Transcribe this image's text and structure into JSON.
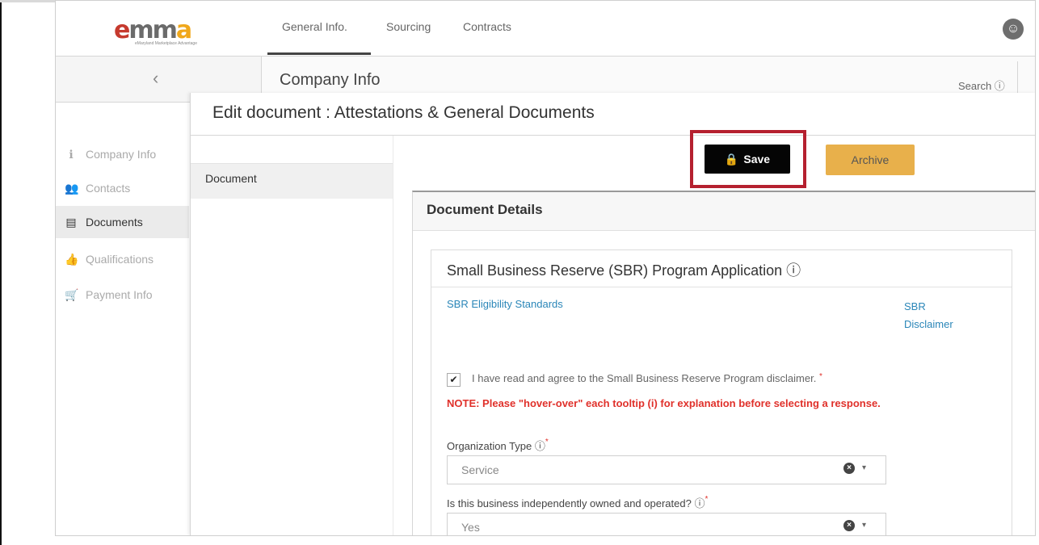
{
  "app": {
    "logo_text": "emma",
    "logo_tagline": "eMaryland Marketplace Advantage",
    "nav_tabs": [
      "General Info.",
      "Sourcing",
      "Contracts"
    ],
    "accessibility_icon": "accessibility-icon"
  },
  "subheader": {
    "back_icon": "chevron-left-icon",
    "section_title": "Company Info",
    "search_label": "Search ⓘ"
  },
  "sidebar": {
    "items": [
      {
        "label": "Company Info",
        "icon": "info-icon",
        "glyph": "ℹ",
        "active": false
      },
      {
        "label": "Contacts",
        "icon": "contacts-icon",
        "glyph": "👥",
        "active": false
      },
      {
        "label": "Documents",
        "icon": "book-icon",
        "glyph": "▤",
        "active": true
      },
      {
        "label": "Qualifications",
        "icon": "thumbs-up-icon",
        "glyph": "👍",
        "active": false
      },
      {
        "label": "Payment Info",
        "icon": "cart-icon",
        "glyph": "🛒",
        "active": false
      }
    ]
  },
  "modal": {
    "title": "Edit document : Attestations & General Documents",
    "left_tab": "Document",
    "save_label": "Save",
    "archive_label": "Archive",
    "highlight_color": "#b5202f"
  },
  "details": {
    "title": "Document Details",
    "card_title": "Small Business Reserve (SBR) Program Application ⓘ",
    "link_standards": "SBR Eligibility Standards",
    "link_disclaimer_1": "SBR",
    "link_disclaimer_2": "Disclaimer",
    "agree_text": "I have read and agree to the Small Business Reserve Program disclaimer.",
    "agree_checked": true,
    "note_text": "NOTE: Please \"hover-over\" each tooltip (i) for explanation before selecting a response.",
    "org_type_label": "Organization Type ⓘ",
    "org_type_value": "Service",
    "owned_label": "Is this business independently owned and operated? ⓘ",
    "owned_value": "Yes"
  }
}
